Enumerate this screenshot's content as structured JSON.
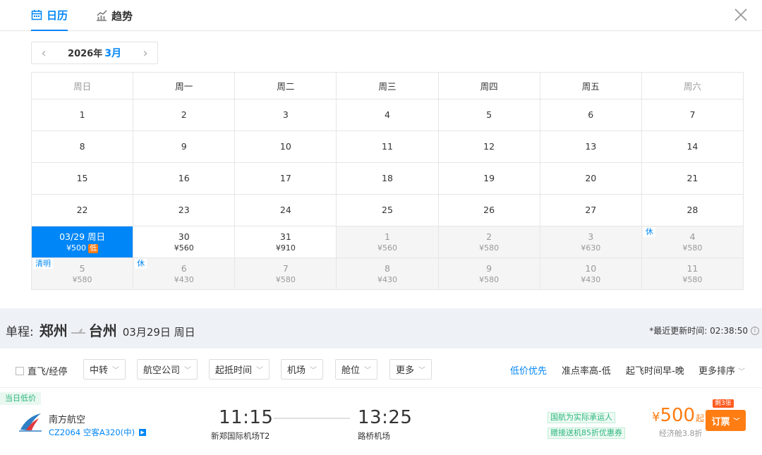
{
  "tabs": {
    "calendar": "日历",
    "trend": "趋势"
  },
  "month_selector": {
    "year": "2026年",
    "month": "3月"
  },
  "weekdays": [
    "周日",
    "周一",
    "周二",
    "周三",
    "周四",
    "周五",
    "周六"
  ],
  "calendar": {
    "weeks": [
      [
        {
          "day": "1"
        },
        {
          "day": "2"
        },
        {
          "day": "3"
        },
        {
          "day": "4"
        },
        {
          "day": "5"
        },
        {
          "day": "6"
        },
        {
          "day": "7"
        }
      ],
      [
        {
          "day": "8"
        },
        {
          "day": "9"
        },
        {
          "day": "10"
        },
        {
          "day": "11"
        },
        {
          "day": "12"
        },
        {
          "day": "13"
        },
        {
          "day": "14"
        }
      ],
      [
        {
          "day": "15"
        },
        {
          "day": "16"
        },
        {
          "day": "17"
        },
        {
          "day": "18"
        },
        {
          "day": "19"
        },
        {
          "day": "20"
        },
        {
          "day": "21"
        }
      ],
      [
        {
          "day": "22"
        },
        {
          "day": "23"
        },
        {
          "day": "24"
        },
        {
          "day": "25"
        },
        {
          "day": "26"
        },
        {
          "day": "27"
        },
        {
          "day": "28"
        }
      ],
      [
        {
          "day": "03/29 周日",
          "price": "¥500",
          "low": "低",
          "selected": true
        },
        {
          "day": "30",
          "price": "¥560"
        },
        {
          "day": "31",
          "price": "¥910"
        },
        {
          "day": "1",
          "price": "¥560",
          "next": true
        },
        {
          "day": "2",
          "price": "¥580",
          "next": true
        },
        {
          "day": "3",
          "price": "¥630",
          "next": true
        },
        {
          "day": "4",
          "price": "¥580",
          "next": true,
          "holiday": "休"
        }
      ],
      [
        {
          "day": "5",
          "price": "¥580",
          "next": true,
          "holiday": "清明"
        },
        {
          "day": "6",
          "price": "¥430",
          "next": true,
          "holiday": "休"
        },
        {
          "day": "7",
          "price": "¥580",
          "next": true
        },
        {
          "day": "8",
          "price": "¥430",
          "next": true
        },
        {
          "day": "9",
          "price": "¥580",
          "next": true
        },
        {
          "day": "10",
          "price": "¥430",
          "next": true
        },
        {
          "day": "11",
          "price": "¥580",
          "next": true
        }
      ]
    ]
  },
  "route": {
    "label": "单程:",
    "from": "郑州",
    "to": "台州",
    "date": "03月29日 周日"
  },
  "updated": "*最近更新时间: 02:38:50",
  "filters": {
    "direct": "直飞/经停",
    "dropdowns": [
      "中转",
      "航空公司",
      "起抵时间",
      "机场",
      "舱位",
      "更多"
    ],
    "sorts": [
      "低价优先",
      "准点率高-低",
      "起飞时间早-晚",
      "更多排序"
    ]
  },
  "flight": {
    "tag": "当日低价",
    "airline": "南方航空",
    "flight_no": "CZ2064 空客A320(中)",
    "dep_time": "11:15",
    "dep_airport": "新郑国际机场T2",
    "arr_time": "13:25",
    "arr_airport": "路桥机场",
    "tag1": "国航为实际承运人",
    "tag2": "赠接送机85折优惠券",
    "currency": "¥",
    "price": "500",
    "price_suffix": "起",
    "cabin": "经济舱3.8折",
    "remaining": "剩3张",
    "book": "订票"
  },
  "colors": {
    "accent": "#0086f6",
    "orange": "#ff7d13",
    "green": "#2cb67d"
  }
}
